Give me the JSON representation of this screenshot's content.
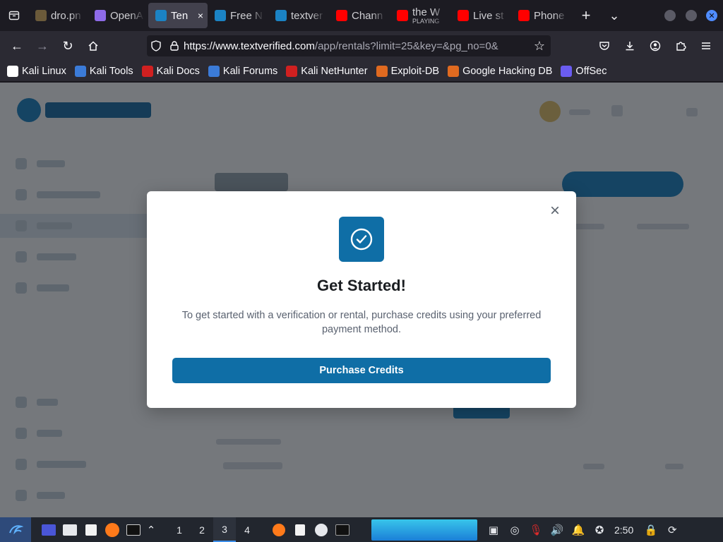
{
  "browser": {
    "tabs": [
      {
        "title": "dro.pn",
        "favicon": "image-icon",
        "color": "#6b5a3a"
      },
      {
        "title": "OpenAI",
        "favicon": "openai-icon",
        "color": "#8e6be8"
      },
      {
        "title": "Ten",
        "favicon": "textverified-icon",
        "color": "#1b83c4",
        "active": true,
        "close": "×"
      },
      {
        "title": "Free N",
        "favicon": "textverified-icon",
        "color": "#1b83c4"
      },
      {
        "title": "textver",
        "favicon": "textverified-icon",
        "color": "#1b83c4"
      },
      {
        "title": "Chann",
        "favicon": "youtube-icon",
        "color": "#ff0000"
      },
      {
        "title": "the W",
        "subtitle": "PLAYING",
        "favicon": "youtube-icon",
        "color": "#ff0000"
      },
      {
        "title": "Live st",
        "favicon": "youtube-icon",
        "color": "#ff0000"
      },
      {
        "title": "Phone",
        "favicon": "youtube-icon",
        "color": "#ff0000"
      }
    ],
    "new_tab": "+",
    "tab_list": "⌄",
    "url": {
      "host": "https://www.textverified.com",
      "rest": "/app/rentals?limit=25&key=&pg_no=0&"
    }
  },
  "bookmarks": [
    {
      "label": "Kali Linux",
      "icon": "kali-icon",
      "color": "#ffffff"
    },
    {
      "label": "Kali Tools",
      "icon": "kali-tools-icon",
      "color": "#3b7bd8"
    },
    {
      "label": "Kali Docs",
      "icon": "kali-docs-icon",
      "color": "#d02020"
    },
    {
      "label": "Kali Forums",
      "icon": "kali-forums-icon",
      "color": "#3b7bd8"
    },
    {
      "label": "Kali NetHunter",
      "icon": "nethunter-icon",
      "color": "#d02020"
    },
    {
      "label": "Exploit-DB",
      "icon": "exploit-db-icon",
      "color": "#e06a20"
    },
    {
      "label": "Google Hacking DB",
      "icon": "ghdb-icon",
      "color": "#e06a20"
    },
    {
      "label": "OffSec",
      "icon": "offsec-icon",
      "color": "#6a5cf0"
    }
  ],
  "modal": {
    "title": "Get Started!",
    "text": "To get started with a verification or rental, purchase credits using your preferred payment method.",
    "button": "Purchase Credits",
    "close": "×",
    "accent": "#0f6ea6"
  },
  "taskbar": {
    "workspaces": [
      "1",
      "2",
      "3",
      "4"
    ],
    "active_workspace": "3",
    "time": "2:50"
  }
}
